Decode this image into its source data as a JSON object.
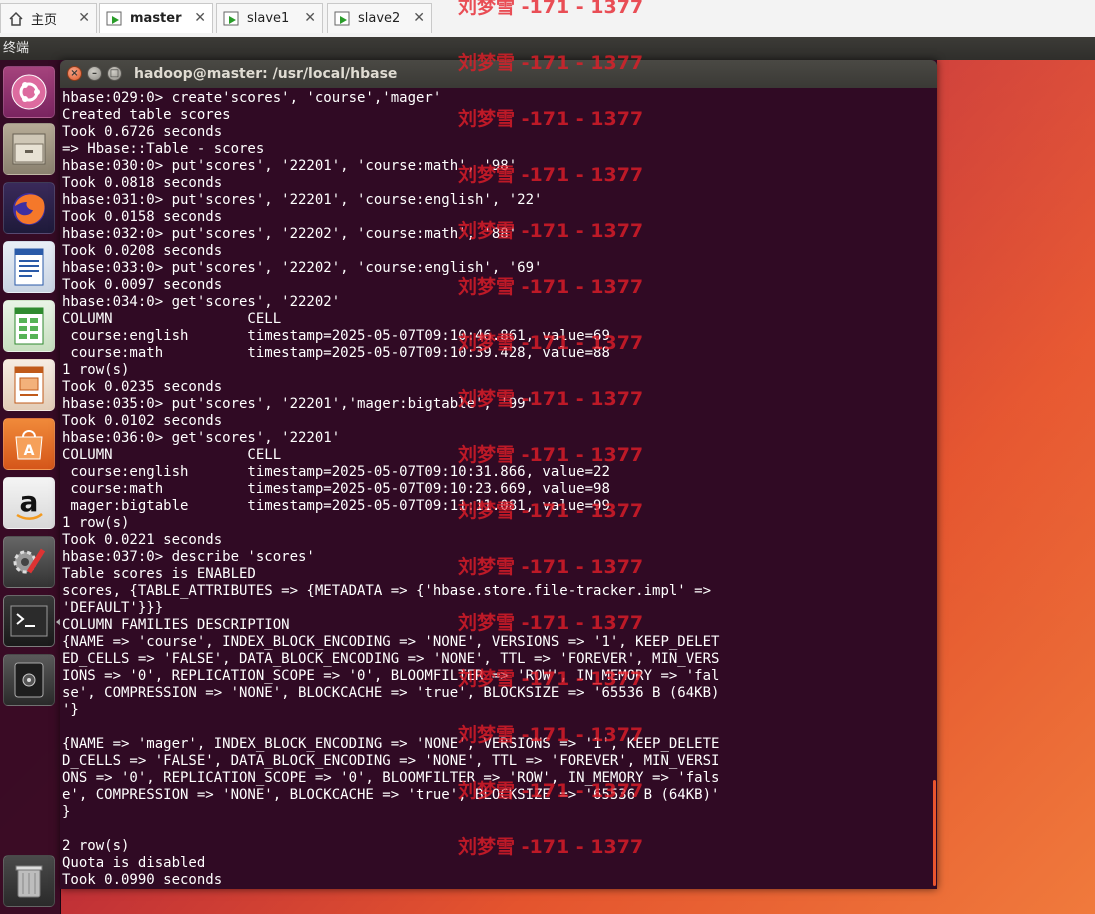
{
  "tabs": [
    {
      "label": "主页",
      "icon": "home-icon",
      "active": false
    },
    {
      "label": "master",
      "icon": "vm-icon",
      "active": true
    },
    {
      "label": "slave1",
      "icon": "vm-icon",
      "active": false
    },
    {
      "label": "slave2",
      "icon": "vm-icon",
      "active": false
    }
  ],
  "menubar": {
    "app_name": "终端"
  },
  "launcher": [
    {
      "name": "ubuntu-dash-icon"
    },
    {
      "name": "files-icon"
    },
    {
      "name": "firefox-icon"
    },
    {
      "name": "writer-icon"
    },
    {
      "name": "calc-icon"
    },
    {
      "name": "impress-icon"
    },
    {
      "name": "software-center-icon"
    },
    {
      "name": "amazon-icon"
    },
    {
      "name": "settings-icon"
    },
    {
      "name": "terminal-icon"
    },
    {
      "name": "disk-icon"
    },
    {
      "name": "trash-icon"
    }
  ],
  "window": {
    "title": "hadoop@master: /usr/local/hbase"
  },
  "terminal_lines": [
    "hbase:029:0> create'scores', 'course','mager'",
    "Created table scores",
    "Took 0.6726 seconds",
    "=> Hbase::Table - scores",
    "hbase:030:0> put'scores', '22201', 'course:math', '98'",
    "Took 0.0818 seconds",
    "hbase:031:0> put'scores', '22201', 'course:english', '22'",
    "Took 0.0158 seconds",
    "hbase:032:0> put'scores', '22202', 'course:math', '88'",
    "Took 0.0208 seconds",
    "hbase:033:0> put'scores', '22202', 'course:english', '69'",
    "Took 0.0097 seconds",
    "hbase:034:0> get'scores', '22202'",
    "COLUMN                CELL",
    " course:english       timestamp=2025-05-07T09:10:46.861, value=69",
    " course:math          timestamp=2025-05-07T09:10:39.428, value=88",
    "1 row(s)",
    "Took 0.0235 seconds",
    "hbase:035:0> put'scores', '22201','mager:bigtable', '99'",
    "Took 0.0102 seconds",
    "hbase:036:0> get'scores', '22201'",
    "COLUMN                CELL",
    " course:english       timestamp=2025-05-07T09:10:31.866, value=22",
    " course:math          timestamp=2025-05-07T09:10:23.669, value=98",
    " mager:bigtable       timestamp=2025-05-07T09:11:11.081, value=99",
    "1 row(s)",
    "Took 0.0221 seconds",
    "hbase:037:0> describe 'scores'",
    "Table scores is ENABLED",
    "scores, {TABLE_ATTRIBUTES => {METADATA => {'hbase.store.file-tracker.impl' =>",
    "'DEFAULT'}}}",
    "COLUMN FAMILIES DESCRIPTION",
    "{NAME => 'course', INDEX_BLOCK_ENCODING => 'NONE', VERSIONS => '1', KEEP_DELET",
    "ED_CELLS => 'FALSE', DATA_BLOCK_ENCODING => 'NONE', TTL => 'FOREVER', MIN_VERS",
    "IONS => '0', REPLICATION_SCOPE => '0', BLOOMFILTER => 'ROW', IN_MEMORY => 'fal",
    "se', COMPRESSION => 'NONE', BLOCKCACHE => 'true', BLOCKSIZE => '65536 B (64KB)",
    "'}",
    "",
    "{NAME => 'mager', INDEX_BLOCK_ENCODING => 'NONE', VERSIONS => '1', KEEP_DELETE",
    "D_CELLS => 'FALSE', DATA_BLOCK_ENCODING => 'NONE', TTL => 'FOREVER', MIN_VERSI",
    "ONS => '0', REPLICATION_SCOPE => '0', BLOOMFILTER => 'ROW', IN_MEMORY => 'fals",
    "e', COMPRESSION => 'NONE', BLOCKCACHE => 'true', BLOCKSIZE => '65536 B (64KB)'",
    "}",
    "",
    "2 row(s)",
    "Quota is disabled",
    "Took 0.0990 seconds"
  ],
  "watermark": {
    "text": "刘梦雪 -171 - 1377",
    "color": "#e61e28"
  }
}
